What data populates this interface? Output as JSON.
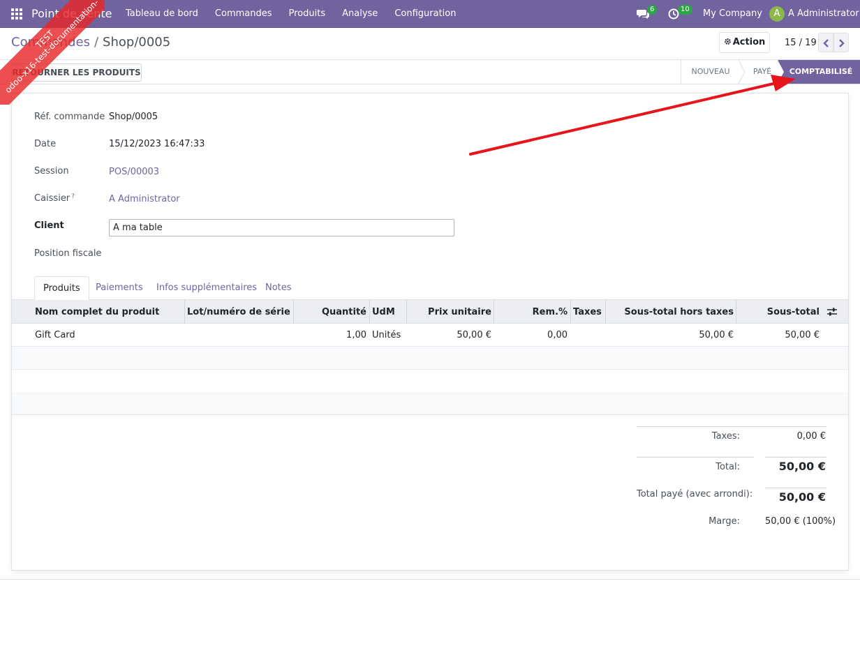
{
  "navbar": {
    "app_name": "Point de vente",
    "menu": [
      "Tableau de bord",
      "Commandes",
      "Produits",
      "Analyse",
      "Configuration"
    ],
    "messages_count": "6",
    "activities_count": "10",
    "company": "My Company",
    "user_initial": "A",
    "user_name": "A Administrator"
  },
  "ribbon": {
    "line1": "TEST",
    "line2": "odoo-x16-test-documentation-"
  },
  "breadcrumb": {
    "parent": "Commandes",
    "separator": "/",
    "current": "Shop/0005"
  },
  "control": {
    "action_label": "Action",
    "pager": "15 / 19"
  },
  "statusbar": {
    "return_button": "RETOURNER LES PRODUITS",
    "stages": [
      "NOUVEAU",
      "PAYÉ",
      "COMPTABILISÉ"
    ],
    "active_stage": "COMPTABILISÉ"
  },
  "form": {
    "ref_label": "Réf. commande",
    "ref_value": "Shop/0005",
    "date_label": "Date",
    "date_value": "15/12/2023 16:47:33",
    "session_label": "Session",
    "session_value": "POS/00003",
    "cashier_label": "Caissier",
    "cashier_help": "?",
    "cashier_value": "A Administrator",
    "client_label": "Client",
    "client_value": "A ma table",
    "fiscal_label": "Position fiscale"
  },
  "tabs": [
    "Produits",
    "Paiements",
    "Infos supplémentaires",
    "Notes"
  ],
  "table": {
    "headers": [
      "Nom complet du produit",
      "Lot/numéro de série",
      "Quantité",
      "UdM",
      "Prix unitaire",
      "Rem.%",
      "Taxes",
      "Sous-total hors taxes",
      "Sous-total"
    ],
    "rows": [
      {
        "product": "Gift Card",
        "lot": "",
        "qty": "1,00",
        "uom": "Unités",
        "price": "50,00 €",
        "discount": "0,00",
        "taxes": "",
        "subtotal_excl": "50,00 €",
        "subtotal": "50,00 €"
      }
    ]
  },
  "totals": {
    "taxes_label": "Taxes:",
    "taxes_value": "0,00 €",
    "total_label": "Total:",
    "total_value": "50,00 €",
    "paid_label": "Total payé (avec arrondi):",
    "paid_value": "50,00 €",
    "margin_label": "Marge:",
    "margin_value": "50,00 € (100%)"
  },
  "colors": {
    "brand": "#71639e",
    "badge": "#28a745",
    "annotation_arrow": "#e8141c"
  }
}
